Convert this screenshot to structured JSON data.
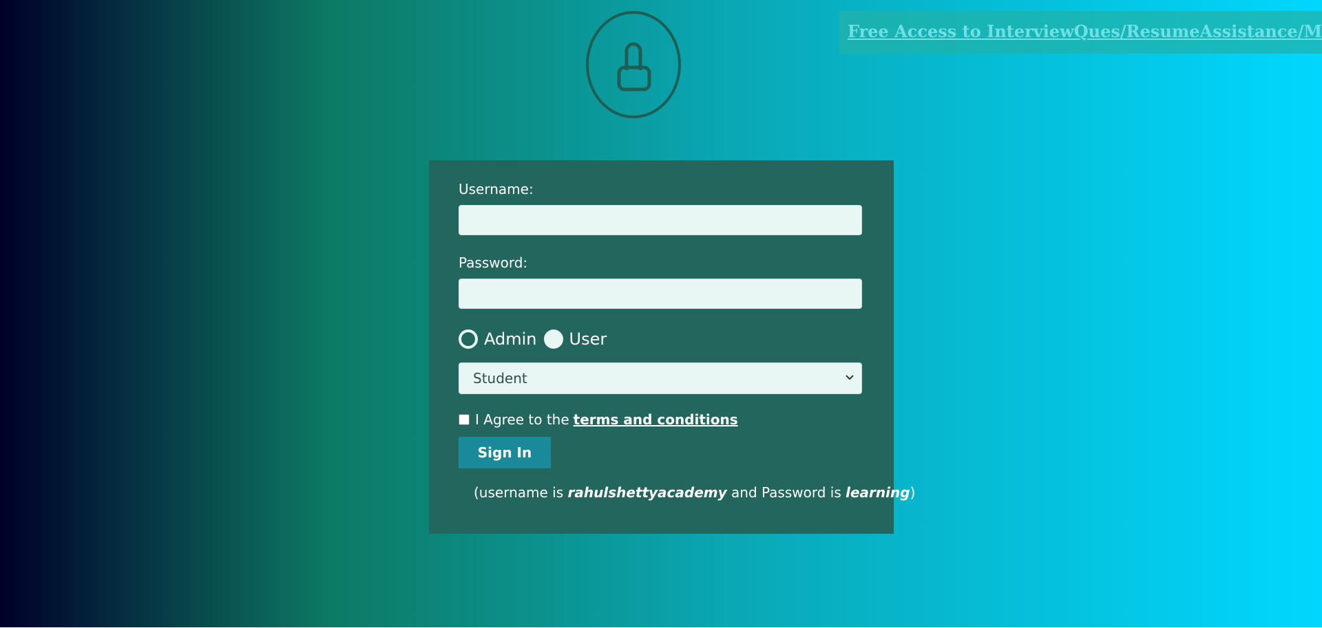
{
  "promo": {
    "link_text": "Free Access to InterviewQues/ResumeAssistance/Material"
  },
  "icons": {
    "lock": "lock-icon",
    "chevron": "chevron-down-icon"
  },
  "form": {
    "username_label": "Username:",
    "username_value": "",
    "password_label": "Password:",
    "password_value": "",
    "role_options": [
      {
        "label": "Admin",
        "selected": true
      },
      {
        "label": "User",
        "selected": false
      }
    ],
    "select": {
      "selected": "Student"
    },
    "terms": {
      "prefix": "I Agree to the",
      "link": "terms and conditions",
      "checked": false
    },
    "signin_label": "Sign In",
    "hint": {
      "open": "(username is",
      "username": "rahulshettyacademy",
      "mid": "and Password is",
      "password": "learning",
      "close": ")"
    }
  },
  "colors": {
    "card": "#22665e",
    "button": "#1a8a9a",
    "input_bg": "#e8f6f4",
    "promo_bg": "#20b2aa",
    "promo_text": "#6fe0e6"
  }
}
